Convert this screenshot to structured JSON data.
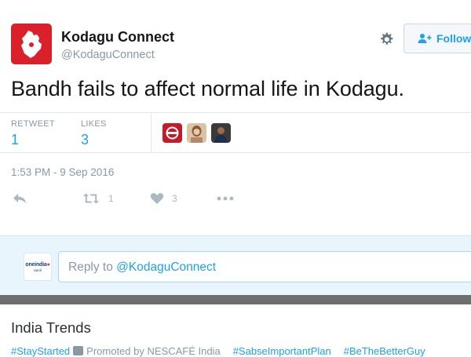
{
  "account": {
    "name": "Kodagu Connect",
    "handle": "@KodaguConnect"
  },
  "header": {
    "follow_label": "Follow"
  },
  "tweet": {
    "text": "Bandh fails to affect normal life in Kodagu."
  },
  "stats": {
    "retweets_label": "RETWEET",
    "retweets_count": "1",
    "likes_label": "LIKES",
    "likes_count": "3"
  },
  "timestamp": "1:53 PM - 9 Sep 2016",
  "actions": {
    "retweet_count": "1",
    "like_count": "3"
  },
  "reply": {
    "prefix": "Reply to ",
    "mention": "@KodaguConnect",
    "avatar_text": "oneindia",
    "avatar_subtext": "tamil"
  },
  "trends": {
    "title": "India Trends",
    "items": [
      "#StayStarted",
      "#SabseImportantPlan",
      "#BeTheBetterGuy"
    ],
    "promoted_by": "Promoted by NESCAFÉ India"
  },
  "colors": {
    "accent": "#1da1f2",
    "muted": "#8899a6",
    "brand": "#d9202b",
    "reply_bg": "#e8f5fd"
  }
}
